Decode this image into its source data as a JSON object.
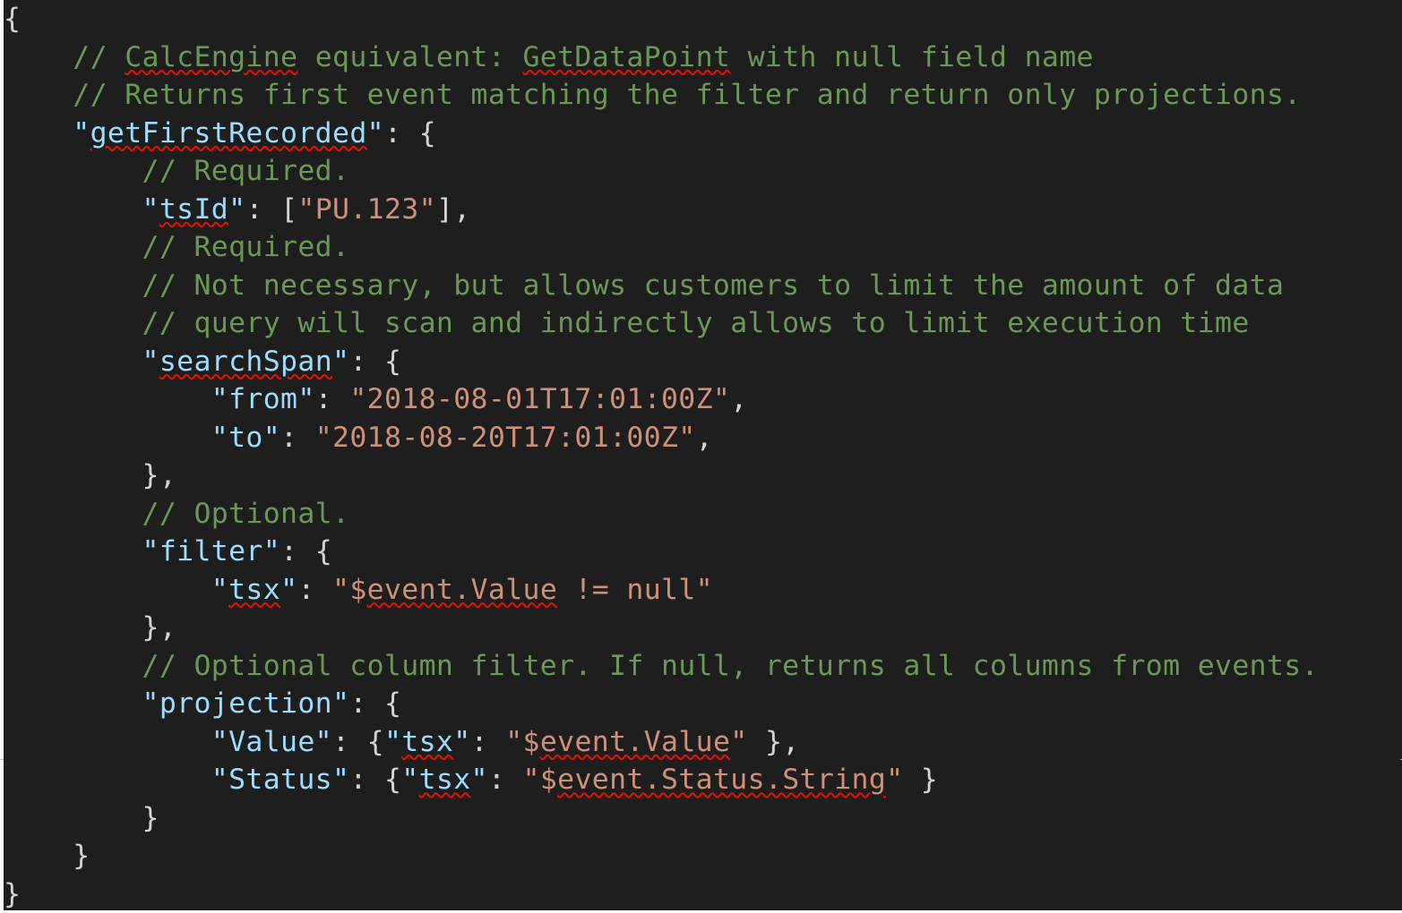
{
  "editor": {
    "colors": {
      "background": "#1e1e1e",
      "comment": "#6a9955",
      "key": "#9cdcfe",
      "string": "#ce9178",
      "punctuation": "#d4d4d4",
      "spellcheck_squiggle": "#e51400"
    },
    "lines": [
      {
        "tokens": [
          {
            "t": "{",
            "c": "punct"
          }
        ]
      },
      {
        "tokens": [
          {
            "t": "    ",
            "c": "punct"
          },
          {
            "t": "// ",
            "c": "comment"
          },
          {
            "t": "CalcEngine",
            "c": "comment",
            "sq": true
          },
          {
            "t": " equivalent: ",
            "c": "comment"
          },
          {
            "t": "GetDataPoint",
            "c": "comment",
            "sq": true
          },
          {
            "t": " with null field name",
            "c": "comment"
          }
        ]
      },
      {
        "tokens": [
          {
            "t": "    ",
            "c": "punct"
          },
          {
            "t": "// Returns first event matching the filter and return only projections.",
            "c": "comment"
          }
        ]
      },
      {
        "tokens": [
          {
            "t": "    ",
            "c": "punct"
          },
          {
            "t": "\"",
            "c": "key"
          },
          {
            "t": "getFirstRecorded",
            "c": "key",
            "sq": true
          },
          {
            "t": "\"",
            "c": "key"
          },
          {
            "t": ": {",
            "c": "punct"
          }
        ]
      },
      {
        "tokens": [
          {
            "t": "        ",
            "c": "punct"
          },
          {
            "t": "// Required.",
            "c": "comment"
          }
        ]
      },
      {
        "tokens": [
          {
            "t": "        ",
            "c": "punct"
          },
          {
            "t": "\"",
            "c": "key"
          },
          {
            "t": "tsId",
            "c": "key",
            "sq": true
          },
          {
            "t": "\"",
            "c": "key"
          },
          {
            "t": ": [",
            "c": "punct"
          },
          {
            "t": "\"PU.123\"",
            "c": "string"
          },
          {
            "t": "],",
            "c": "punct"
          }
        ]
      },
      {
        "tokens": [
          {
            "t": "        ",
            "c": "punct"
          },
          {
            "t": "// Required.",
            "c": "comment"
          }
        ]
      },
      {
        "tokens": [
          {
            "t": "        ",
            "c": "punct"
          },
          {
            "t": "// Not necessary, but allows customers to limit the amount of data",
            "c": "comment"
          }
        ]
      },
      {
        "tokens": [
          {
            "t": "        ",
            "c": "punct"
          },
          {
            "t": "// query will scan and indirectly allows to limit execution time",
            "c": "comment"
          }
        ]
      },
      {
        "tokens": [
          {
            "t": "        ",
            "c": "punct"
          },
          {
            "t": "\"",
            "c": "key"
          },
          {
            "t": "searchSpan",
            "c": "key",
            "sq": true
          },
          {
            "t": "\"",
            "c": "key"
          },
          {
            "t": ": {",
            "c": "punct"
          }
        ]
      },
      {
        "tokens": [
          {
            "t": "            ",
            "c": "punct"
          },
          {
            "t": "\"from\"",
            "c": "key"
          },
          {
            "t": ": ",
            "c": "punct"
          },
          {
            "t": "\"2018-08-01T17:01:00Z\"",
            "c": "string"
          },
          {
            "t": ",",
            "c": "punct"
          }
        ]
      },
      {
        "tokens": [
          {
            "t": "            ",
            "c": "punct"
          },
          {
            "t": "\"to\"",
            "c": "key"
          },
          {
            "t": ": ",
            "c": "punct"
          },
          {
            "t": "\"2018-08-20T17:01:00Z\"",
            "c": "string"
          },
          {
            "t": ",",
            "c": "punct"
          }
        ]
      },
      {
        "tokens": [
          {
            "t": "        },",
            "c": "punct"
          }
        ]
      },
      {
        "tokens": [
          {
            "t": "        ",
            "c": "punct"
          },
          {
            "t": "// Optional.",
            "c": "comment"
          }
        ]
      },
      {
        "tokens": [
          {
            "t": "        ",
            "c": "punct"
          },
          {
            "t": "\"filter\"",
            "c": "key"
          },
          {
            "t": ": {",
            "c": "punct"
          }
        ]
      },
      {
        "tokens": [
          {
            "t": "            ",
            "c": "punct"
          },
          {
            "t": "\"",
            "c": "key"
          },
          {
            "t": "tsx",
            "c": "key",
            "sq": true
          },
          {
            "t": "\"",
            "c": "key"
          },
          {
            "t": ": ",
            "c": "punct"
          },
          {
            "t": "\"$",
            "c": "string"
          },
          {
            "t": "event.Value",
            "c": "string",
            "sq": true
          },
          {
            "t": " != null\"",
            "c": "string"
          }
        ]
      },
      {
        "tokens": [
          {
            "t": "        },",
            "c": "punct"
          }
        ]
      },
      {
        "tokens": [
          {
            "t": "        ",
            "c": "punct"
          },
          {
            "t": "// Optional column filter. If null, returns all columns from events.",
            "c": "comment"
          }
        ]
      },
      {
        "tokens": [
          {
            "t": "        ",
            "c": "punct"
          },
          {
            "t": "\"projection\"",
            "c": "key"
          },
          {
            "t": ": {",
            "c": "punct"
          }
        ]
      },
      {
        "tokens": [
          {
            "t": "            ",
            "c": "punct"
          },
          {
            "t": "\"Value\"",
            "c": "key"
          },
          {
            "t": ": {",
            "c": "punct"
          },
          {
            "t": "\"",
            "c": "key"
          },
          {
            "t": "tsx",
            "c": "key",
            "sq": true
          },
          {
            "t": "\"",
            "c": "key"
          },
          {
            "t": ": ",
            "c": "punct"
          },
          {
            "t": "\"$",
            "c": "string"
          },
          {
            "t": "event.Value",
            "c": "string",
            "sq": true
          },
          {
            "t": "\"",
            "c": "string"
          },
          {
            "t": " },",
            "c": "punct"
          }
        ]
      },
      {
        "tokens": [
          {
            "t": "            ",
            "c": "punct"
          },
          {
            "t": "\"Status\"",
            "c": "key"
          },
          {
            "t": ": {",
            "c": "punct"
          },
          {
            "t": "\"",
            "c": "key"
          },
          {
            "t": "tsx",
            "c": "key",
            "sq": true
          },
          {
            "t": "\"",
            "c": "key"
          },
          {
            "t": ": ",
            "c": "punct"
          },
          {
            "t": "\"$",
            "c": "string"
          },
          {
            "t": "event.Status.String",
            "c": "string",
            "sq": true
          },
          {
            "t": "\"",
            "c": "string"
          },
          {
            "t": " }",
            "c": "punct"
          }
        ]
      },
      {
        "tokens": [
          {
            "t": "        }",
            "c": "punct"
          }
        ]
      },
      {
        "tokens": [
          {
            "t": "    }",
            "c": "punct"
          }
        ]
      },
      {
        "tokens": [
          {
            "t": "}",
            "c": "punct"
          }
        ]
      }
    ]
  }
}
